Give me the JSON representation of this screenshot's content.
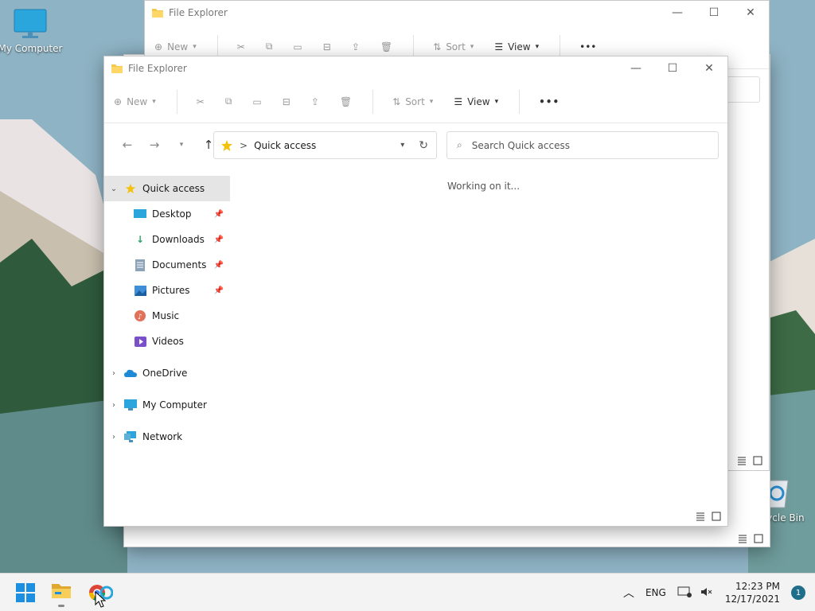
{
  "desktop": {
    "icons": [
      {
        "label": "My Computer"
      },
      {
        "label": "Recycle Bin"
      }
    ]
  },
  "back_window": {
    "title": "File Explorer",
    "toolbar": {
      "new_label": "New",
      "sort_label": "Sort",
      "view_label": "View"
    }
  },
  "window": {
    "title": "File Explorer",
    "toolbar": {
      "new_label": "New",
      "sort_label": "Sort",
      "view_label": "View",
      "more_label": "•••"
    },
    "address": {
      "breadcrumb_sep": ">",
      "location": "Quick access"
    },
    "search": {
      "placeholder": "Search Quick access"
    },
    "status_message": "Working on it...",
    "sidebar": {
      "items": [
        {
          "label": "Quick access",
          "icon": "star-icon"
        },
        {
          "label": "Desktop",
          "icon": "desktop-icon"
        },
        {
          "label": "Downloads",
          "icon": "download-icon"
        },
        {
          "label": "Documents",
          "icon": "document-icon"
        },
        {
          "label": "Pictures",
          "icon": "picture-icon"
        },
        {
          "label": "Music",
          "icon": "music-icon"
        },
        {
          "label": "Videos",
          "icon": "video-icon"
        },
        {
          "label": "OneDrive",
          "icon": "cloud-icon"
        },
        {
          "label": "My Computer",
          "icon": "computer-icon"
        },
        {
          "label": "Network",
          "icon": "network-icon"
        }
      ]
    }
  },
  "taskbar": {
    "language": "ENG",
    "time": "12:23 PM",
    "date": "12/17/2021",
    "notification_count": "1"
  },
  "colors": {
    "accent": "#0067c0",
    "folder": "#f2c94c",
    "selection": "#e5e5e5"
  }
}
